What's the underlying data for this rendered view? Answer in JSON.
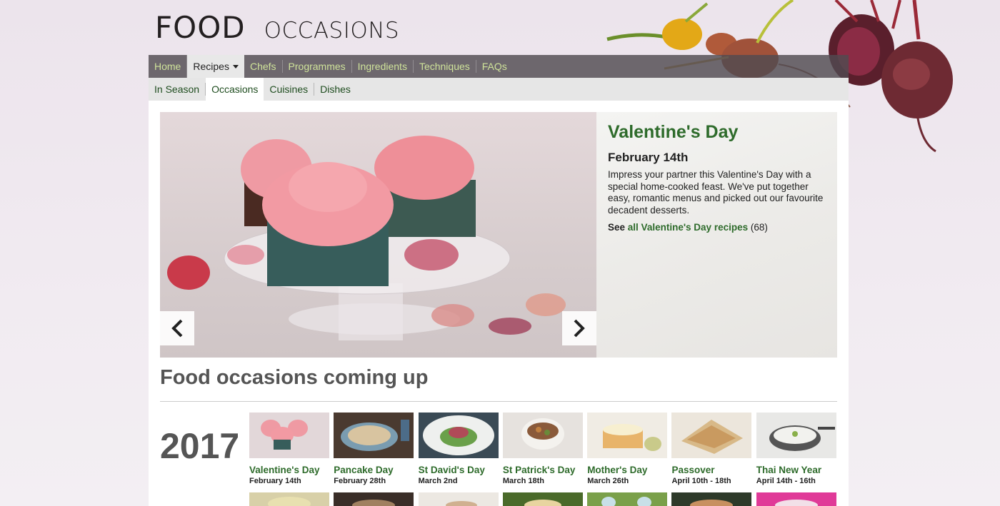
{
  "logo": {
    "word1": "FOOD",
    "word2": "OCCASIONS"
  },
  "main_nav": [
    {
      "label": "Home"
    },
    {
      "label": "Recipes",
      "active": true,
      "has_dropdown": true
    },
    {
      "label": "Chefs"
    },
    {
      "label": "Programmes"
    },
    {
      "label": "Ingredients"
    },
    {
      "label": "Techniques"
    },
    {
      "label": "FAQs"
    }
  ],
  "sub_nav": [
    {
      "label": "In Season"
    },
    {
      "label": "Occasions",
      "active": true
    },
    {
      "label": "Cuisines"
    },
    {
      "label": "Dishes"
    }
  ],
  "hero": {
    "title": "Valentine's Day",
    "date": "February 14th",
    "description": "Impress your partner this Valentine's Day with a special home-cooked feast. We've put together easy, romantic menus and picked out our favourite decadent desserts.",
    "see_prefix": "See",
    "see_link": "all Valentine's Day recipes",
    "see_count": "(68)",
    "prev_icon": "chevron-left-icon",
    "next_icon": "chevron-right-icon"
  },
  "coming_up": {
    "title": "Food occasions coming up",
    "year": "2017",
    "occasions": [
      {
        "name": "Valentine's Day",
        "date": "February 14th"
      },
      {
        "name": "Pancake Day",
        "date": "February 28th"
      },
      {
        "name": "St David's Day",
        "date": "March 2nd"
      },
      {
        "name": "St Patrick's Day",
        "date": "March 18th"
      },
      {
        "name": "Mother's Day",
        "date": "March 26th"
      },
      {
        "name": "Passover",
        "date": "April 10th - 18th"
      },
      {
        "name": "Thai New Year",
        "date": "April 14th - 16th"
      }
    ]
  },
  "colors": {
    "link_green": "#2e6b2b",
    "nav_text": "#cfe39a",
    "nav_bg": "#504b50",
    "page_bg": "#ece4ec"
  }
}
